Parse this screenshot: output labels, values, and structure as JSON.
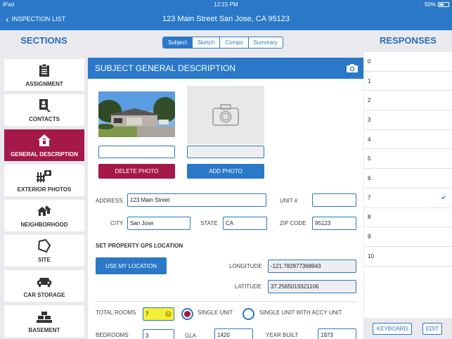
{
  "status": {
    "device": "iPad",
    "time": "12:15 PM",
    "battery": "50%"
  },
  "nav": {
    "back_label": "INSPECTION LIST",
    "title": "123 Main Street San Jose, CA 95123"
  },
  "headers": {
    "sections": "SECTIONS",
    "responses": "RESPONSES"
  },
  "tabs": [
    {
      "label": "Subject",
      "active": true
    },
    {
      "label": "Sketch"
    },
    {
      "label": "Comps"
    },
    {
      "label": "Summary"
    }
  ],
  "sidebar": {
    "items": [
      {
        "label": "ASSIGNMENT",
        "icon": "clipboard-icon"
      },
      {
        "label": "CONTACTS",
        "icon": "contacts-icon"
      },
      {
        "label": "GENERAL DESCRIPTION",
        "icon": "house-info-icon",
        "active": true
      },
      {
        "label": "EXTERIOR PHOTOS",
        "icon": "camera-fence-icon"
      },
      {
        "label": "NEIGHBORHOOD",
        "icon": "neighborhood-icon"
      },
      {
        "label": "SITE",
        "icon": "site-icon"
      },
      {
        "label": "CAR STORAGE",
        "icon": "car-icon"
      },
      {
        "label": "BASEMENT",
        "icon": "bricks-icon"
      }
    ]
  },
  "main": {
    "title": "SUBJECT GENERAL DESCRIPTION",
    "delete_photo": "DELETE PHOTO",
    "add_photo": "ADD PHOTO",
    "address_label": "ADDRESS",
    "address_value": "123 Main Street",
    "unit_label": "UNIT #",
    "unit_value": "",
    "city_label": "CITY",
    "city_value": "San Jose",
    "state_label": "STATE",
    "state_value": "CA",
    "zip_label": "ZIP CODE",
    "zip_value": "95123",
    "gps_title": "SET PROPERTY GPS LOCATION",
    "use_location": "USE MY LOCATION",
    "longitude_label": "LONGITUDE",
    "longitude_value": "-121.782877368943",
    "latitude_label": "LATITUDE",
    "latitude_value": "37.2565019321106",
    "total_rooms_label": "TOTAL ROOMS",
    "total_rooms_value": "7",
    "single_unit_label": "SINGLE UNIT",
    "single_unit_accy_label": "SINGLE UNIT WITH ACCY UNIT",
    "bedrooms_label": "BEDROOMS",
    "bedrooms_value": "3",
    "gla_label": "GLA",
    "gla_value": "1420",
    "year_built_label": "YEAR BUILT",
    "year_built_value": "1973"
  },
  "responses": {
    "items": [
      "0",
      "1",
      "2",
      "3",
      "4",
      "5",
      "6",
      "7",
      "8",
      "9",
      "10"
    ],
    "selected": "7",
    "keyboard": "KEYBOARD",
    "edit": "EDIT"
  },
  "colors": {
    "accent": "#2a78c7",
    "active": "#a4184a",
    "highlight": "#f3f03a"
  }
}
